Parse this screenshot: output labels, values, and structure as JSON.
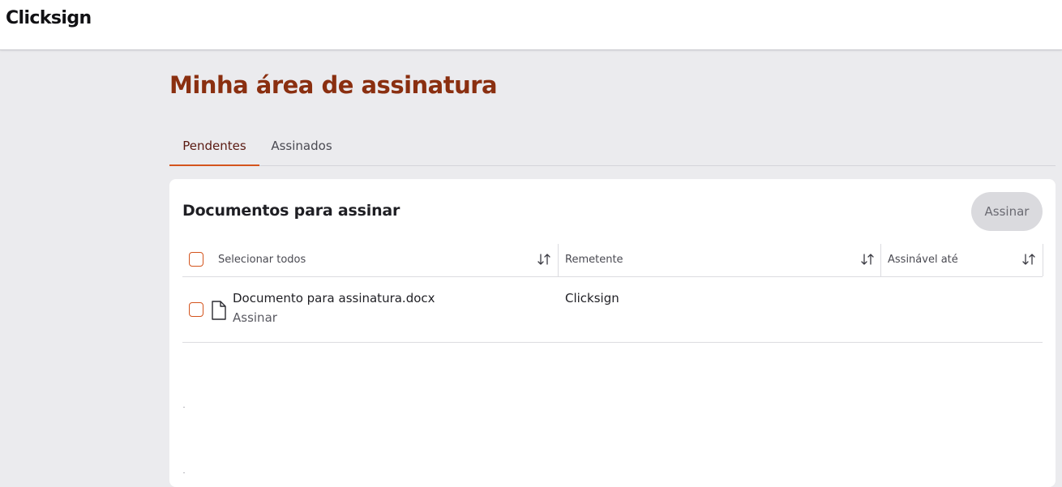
{
  "header": {
    "logo": "Clicksign"
  },
  "page": {
    "title": "Minha área de assinatura"
  },
  "tabs": [
    {
      "label": "Pendentes",
      "active": true
    },
    {
      "label": "Assinados",
      "active": false
    }
  ],
  "card": {
    "title": "Documentos para assinar",
    "sign_button": "Assinar"
  },
  "table": {
    "columns": [
      {
        "label": "Selecionar todos",
        "icon": "sort-icon"
      },
      {
        "label": "Remetente",
        "icon": "sort-icon"
      },
      {
        "label": "Assinável até",
        "icon": "sort-icon"
      }
    ],
    "rows": [
      {
        "document": "Documento para assinatura.docx",
        "action": "Assinar",
        "sender": "Clicksign",
        "until": "",
        "icon": "document-icon"
      }
    ]
  },
  "colors": {
    "title": "#8a2f10",
    "accent": "#d4541d",
    "background": "#ebebee",
    "card": "#ffffff"
  }
}
